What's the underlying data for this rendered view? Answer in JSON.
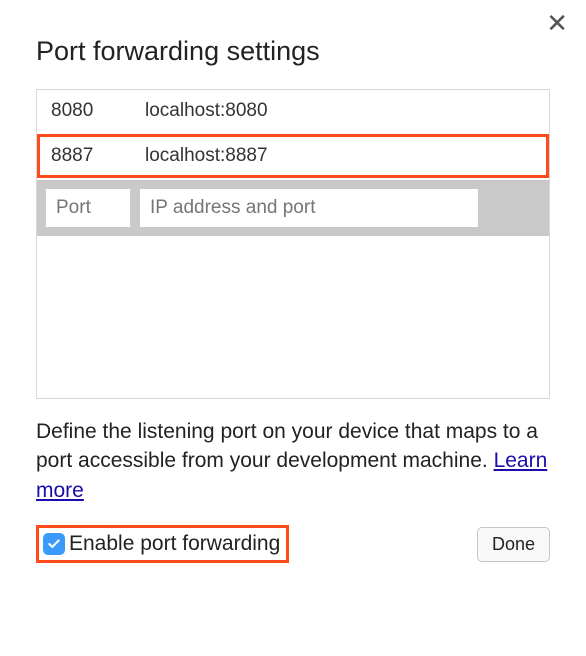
{
  "dialog": {
    "title": "Port forwarding settings",
    "rows": [
      {
        "port": "8080",
        "addr": "localhost:8080",
        "highlighted": false
      },
      {
        "port": "8887",
        "addr": "localhost:8887",
        "highlighted": true
      }
    ],
    "input_row": {
      "port_placeholder": "Port",
      "addr_placeholder": "IP address and port"
    },
    "description": "Define the listening port on your device that maps to a port accessible from your development machine. ",
    "learn_more": "Learn more",
    "checkbox": {
      "checked": true,
      "label": "Enable port forwarding"
    },
    "done_label": "Done"
  }
}
